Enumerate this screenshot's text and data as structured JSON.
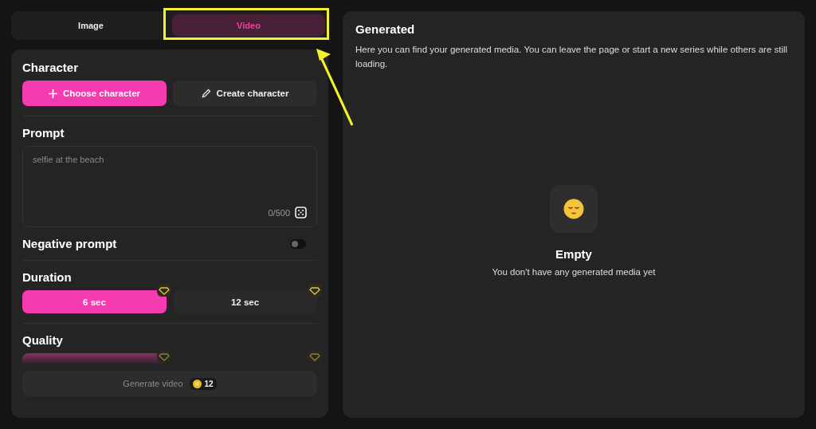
{
  "tabs": [
    {
      "label": "Image",
      "selected": false
    },
    {
      "label": "Video",
      "selected": true
    }
  ],
  "character": {
    "title": "Character",
    "buttons": [
      {
        "label": "Choose character",
        "kind": "primary"
      },
      {
        "label": "Create character",
        "kind": "secondary"
      }
    ]
  },
  "prompt": {
    "title": "Prompt",
    "placeholder": "selfie at the beach",
    "counter": "0/500"
  },
  "negative_prompt": {
    "title": "Negative prompt",
    "on": false
  },
  "duration": {
    "title": "Duration",
    "options": [
      {
        "label": "6 sec",
        "selected": true,
        "premium": true
      },
      {
        "label": "12 sec",
        "selected": false,
        "premium": true
      }
    ]
  },
  "quality": {
    "title": "Quality",
    "options": [
      {
        "selected": true,
        "premium": true
      },
      {
        "selected": false,
        "premium": true
      }
    ]
  },
  "generate": {
    "label": "Generate video",
    "cost": "12",
    "disabled": true
  },
  "generated": {
    "title": "Generated",
    "description": "Here you can find your generated media. You can leave the page or start a new series while others are still loading.",
    "empty_title": "Empty",
    "empty_text": "You don't have any generated media yet"
  }
}
